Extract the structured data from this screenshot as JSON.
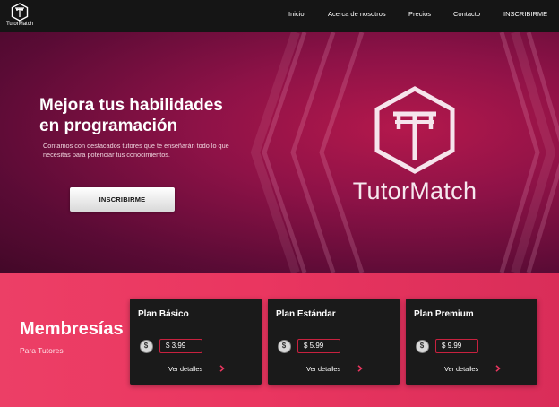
{
  "brand": {
    "name": "TutorMatch",
    "accent": "#e8365f"
  },
  "nav": {
    "items": [
      {
        "label": "Inicio"
      },
      {
        "label": "Acerca de nosotros"
      },
      {
        "label": "Precios"
      },
      {
        "label": "Contacto"
      },
      {
        "label": "INSCRIBIRME"
      }
    ]
  },
  "hero": {
    "title_line1": "Mejora tus habilidades",
    "title_line2": "en programación",
    "description": "Contamos con destacados tutores que te enseñarán todo lo que necesitas para potenciar tus conocimientos.",
    "cta_label": "INSCRIBIRME",
    "logo_text": "TutorMatch"
  },
  "memberships": {
    "title": "Membresías",
    "subtitle": "Para Tutores",
    "plans": [
      {
        "name": "Plan Básico",
        "price": "$ 3.99",
        "details_label": "Ver detalles",
        "icon": "dollar-coin-icon"
      },
      {
        "name": "Plan Estándar",
        "price": "$ 5.99",
        "details_label": "Ver detalles",
        "icon": "dollar-coin-icon"
      },
      {
        "name": "Plan Premium",
        "price": "$ 9.99",
        "details_label": "Ver detalles",
        "icon": "dollar-coin-icon"
      }
    ]
  }
}
